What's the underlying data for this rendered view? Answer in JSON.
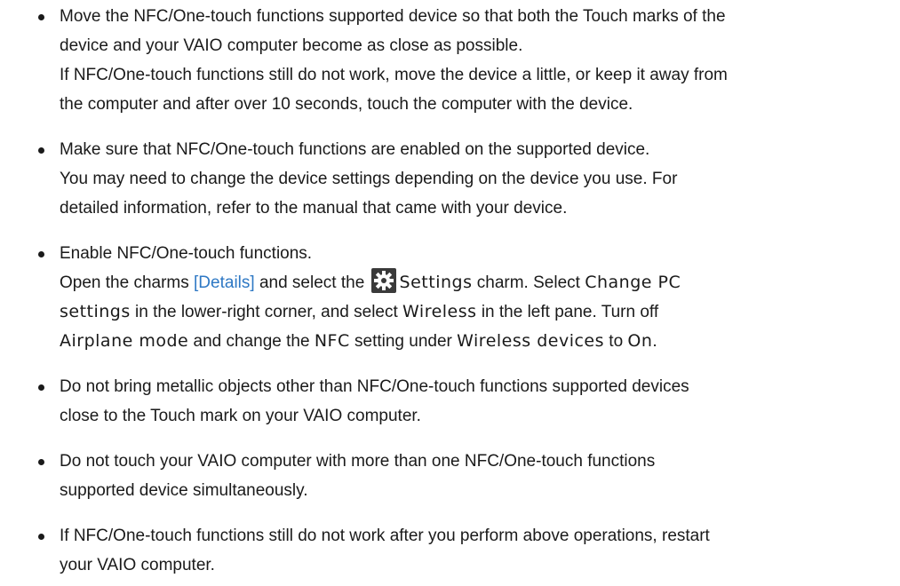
{
  "items": [
    {
      "lines": [
        "Move the NFC/One-touch functions supported device so that both the Touch marks of the",
        "device and your VAIO computer become as close as possible.",
        "If NFC/One-touch functions still do not work, move the device a little, or keep it away from",
        "the computer and after over 10 seconds, touch the computer with the device."
      ]
    },
    {
      "lines": [
        "Make sure that NFC/One-touch functions are enabled on the supported device.",
        "You may need to change the device settings depending on the device you use. For",
        "detailed information, refer to the manual that came with your device."
      ]
    },
    {
      "line1": "Enable NFC/One-touch functions.",
      "l2_a": "Open the charms ",
      "l2_link": "[Details]",
      "l2_b": " and select the ",
      "l2_icon": "settings-gear-icon",
      "l2_ui1": "Settings",
      "l2_c": " charm. Select ",
      "l2_ui2": "Change PC",
      "l3_ui": "settings",
      "l3_a": " in the lower-right corner, and select ",
      "l3_ui2": "Wireless",
      "l3_b": " in the left pane. Turn off",
      "l4_ui": "Airplane mode",
      "l4_a": " and change the ",
      "l4_ui2": "NFC",
      "l4_b": " setting under ",
      "l4_ui3": "Wireless devices",
      "l4_c": " to ",
      "l4_ui4": "On",
      "l4_d": "."
    },
    {
      "lines": [
        "Do not bring metallic objects other than NFC/One-touch functions supported devices",
        "close to the Touch mark on your VAIO computer."
      ]
    },
    {
      "lines": [
        "Do not touch your VAIO computer with more than one NFC/One-touch functions",
        "supported device simultaneously."
      ]
    },
    {
      "lines": [
        "If NFC/One-touch functions still do not work after you perform above operations, restart",
        "your VAIO computer."
      ]
    }
  ],
  "colors": {
    "text": "#1a1a1a",
    "link": "#2e78c4",
    "icon_bg": "#3a3a3a"
  }
}
